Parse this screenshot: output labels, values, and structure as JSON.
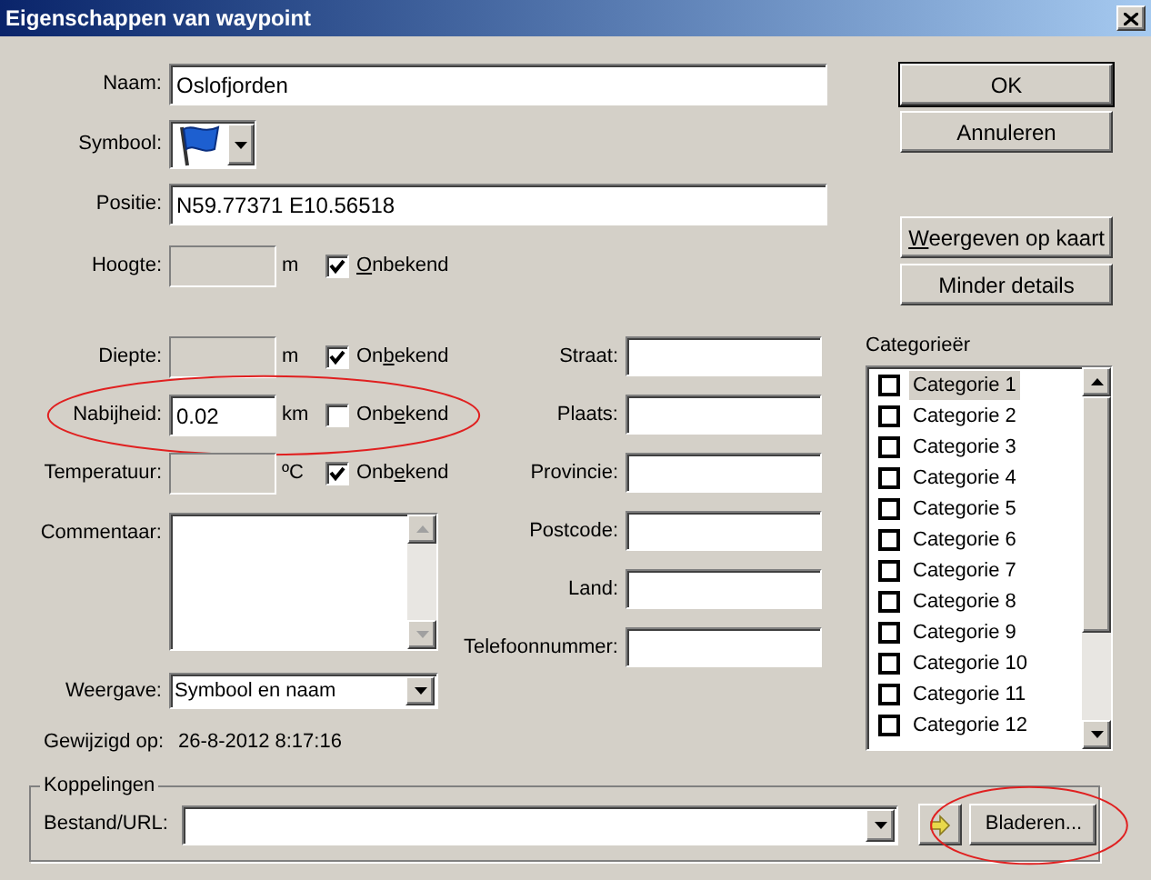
{
  "window": {
    "title": "Eigenschappen van waypoint"
  },
  "name_field": {
    "label": "Naam:",
    "value": "Oslofjorden"
  },
  "symbol_field": {
    "label": "Symbool:"
  },
  "position_field": {
    "label": "Positie:",
    "value": "N59.77371 E10.56518"
  },
  "measure_rows": [
    {
      "label": "Hoogte:",
      "unit": "m",
      "disabled": true,
      "unknown_label": {
        "key": "O",
        "after": "nbekend"
      },
      "unknown_checked": true,
      "circled": false
    },
    {
      "label": "Diepte:",
      "unit": "m",
      "disabled": true,
      "unknown_label": {
        "before": "On",
        "key": "b",
        "after": "ekend"
      },
      "unknown_checked": true,
      "circled": false
    },
    {
      "label": "Nabijheid:",
      "value": "0.02",
      "unit": "km",
      "disabled": false,
      "unknown_label": {
        "before": "Onb",
        "key": "e",
        "after": "kend"
      },
      "unknown_checked": false,
      "circled": true
    },
    {
      "label": "Temperatuur:",
      "unit": "ºC",
      "disabled": true,
      "unknown_label": {
        "before": "Onb",
        "key": "e",
        "after": "kend"
      },
      "unknown_checked": true,
      "circled": false
    }
  ],
  "comment_field": {
    "label": "Commentaar:"
  },
  "display_field": {
    "label": "Weergave:",
    "value": "Symbool en naam"
  },
  "modified": {
    "label": "Gewijzigd op:",
    "value": "26-8-2012 8:17:16"
  },
  "address_fields": [
    {
      "label": "Straat:"
    },
    {
      "label": "Plaats:"
    },
    {
      "label": "Provincie:"
    },
    {
      "label": "Postcode:"
    },
    {
      "label": "Land:"
    },
    {
      "label": "Telefoonnummer:"
    }
  ],
  "categories": {
    "label": "Categorieër",
    "items": [
      {
        "label": "Categorie 1",
        "checked": false,
        "selected": true
      },
      {
        "label": "Categorie 2",
        "checked": false,
        "selected": false
      },
      {
        "label": "Categorie 3",
        "checked": false,
        "selected": false
      },
      {
        "label": "Categorie 4",
        "checked": false,
        "selected": false
      },
      {
        "label": "Categorie 5",
        "checked": false,
        "selected": false
      },
      {
        "label": "Categorie 6",
        "checked": false,
        "selected": false
      },
      {
        "label": "Categorie 7",
        "checked": false,
        "selected": false
      },
      {
        "label": "Categorie 8",
        "checked": false,
        "selected": false
      },
      {
        "label": "Categorie 9",
        "checked": false,
        "selected": false
      },
      {
        "label": "Categorie 10",
        "checked": false,
        "selected": false
      },
      {
        "label": "Categorie 11",
        "checked": false,
        "selected": false
      },
      {
        "label": "Categorie 12",
        "checked": false,
        "selected": false
      }
    ]
  },
  "buttons": [
    {
      "label": "OK",
      "kind": "default"
    },
    {
      "label": "Annuleren",
      "kind": "normal"
    },
    {
      "label": {
        "key": "W",
        "after": "eergeven op kaart"
      },
      "kind": "spaced"
    },
    {
      "label": "Minder details",
      "kind": "normal"
    }
  ],
  "links": {
    "title": "Koppelingen",
    "label": "Bestand/URL:",
    "browse_label": "Bladeren...",
    "browse_circled": true
  }
}
